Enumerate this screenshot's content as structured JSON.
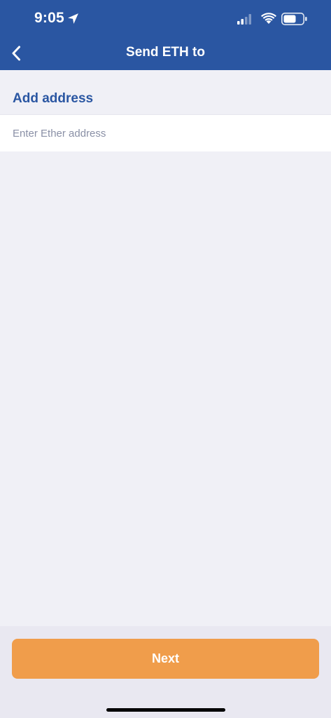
{
  "status_bar": {
    "time": "9:05",
    "icons": [
      "location-arrow-icon",
      "cellular-signal-icon",
      "wifi-icon",
      "battery-icon"
    ]
  },
  "header": {
    "back_icon": "chevron-left-icon",
    "title": "Send ETH to"
  },
  "main": {
    "section_title": "Add address",
    "address_input": {
      "value": "",
      "placeholder": "Enter Ether address"
    }
  },
  "footer": {
    "next_label": "Next"
  },
  "colors": {
    "brand": "#2a56a2",
    "accent": "#f09d4b",
    "background": "#f0f0f6"
  }
}
